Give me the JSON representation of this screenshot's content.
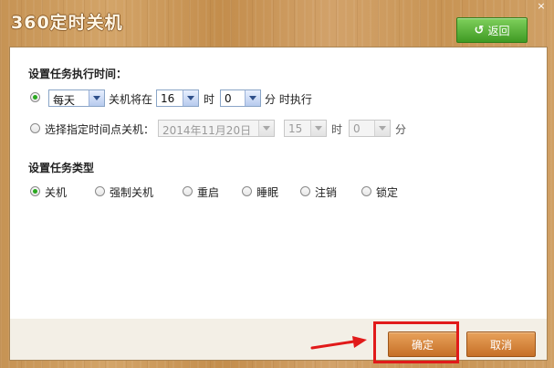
{
  "window": {
    "title": "360定时关机",
    "close_glyph": "×"
  },
  "header": {
    "back_label": "返回",
    "back_icon": "undo-arrow-icon"
  },
  "time_section": {
    "title": "设置任务执行时间：",
    "option_daily": {
      "checked": true,
      "frequency": "每天",
      "label_before_hour": "关机将在",
      "hour": "16",
      "hour_unit": "时",
      "minute": "0",
      "label_after_minute": "分 时执行"
    },
    "option_specific": {
      "checked": false,
      "label": "选择指定时间点关机：",
      "date": "2014年11月20日",
      "hour": "15",
      "hour_unit": "时",
      "minute": "0",
      "minute_unit": "分"
    }
  },
  "type_section": {
    "title": "设置任务类型",
    "options": [
      {
        "label": "关机",
        "checked": true
      },
      {
        "label": "强制关机",
        "checked": false
      },
      {
        "label": "重启",
        "checked": false
      },
      {
        "label": "睡眠",
        "checked": false
      },
      {
        "label": "注销",
        "checked": false
      },
      {
        "label": "锁定",
        "checked": false
      }
    ]
  },
  "footer": {
    "confirm_label": "确定",
    "cancel_label": "取消"
  },
  "colors": {
    "accent_green": "#3f9a23",
    "button_orange": "#c66f27",
    "highlight_red": "#e11a1a"
  }
}
